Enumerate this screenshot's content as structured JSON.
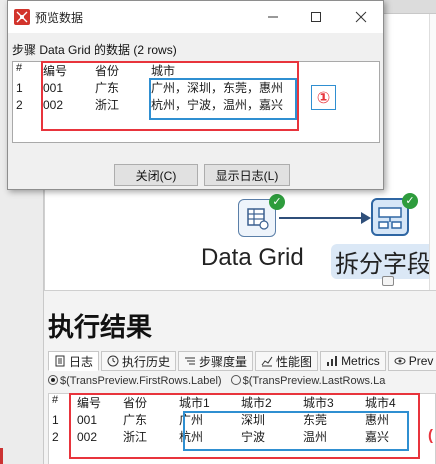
{
  "dialog": {
    "title": "预览数据",
    "caption": "步骤 Data Grid 的数据  (2 rows)",
    "columns": [
      "#",
      "编号",
      "省份",
      "城市"
    ],
    "rows": [
      [
        "1",
        "001",
        "广东",
        "广州，深圳，东莞，惠州"
      ],
      [
        "2",
        "002",
        "浙江",
        "杭州，宁波，温州，嘉兴"
      ]
    ],
    "close_label": "关闭(C)",
    "log_label": "显示日志(L)",
    "annotation_1": "①"
  },
  "canvas": {
    "step1_label": "Data Grid",
    "step2_label": "拆分字段"
  },
  "results": {
    "title": "执行结果",
    "tabs": [
      {
        "label": "日志",
        "icon": "log-icon"
      },
      {
        "label": "执行历史",
        "icon": "history-icon"
      },
      {
        "label": "步骤度量",
        "icon": "step-metrics-icon"
      },
      {
        "label": "性能图",
        "icon": "chart-icon"
      },
      {
        "label": "Metrics",
        "icon": "metrics-icon"
      },
      {
        "label": "Prev",
        "icon": "preview-eye-icon"
      }
    ],
    "radio_first": "$(TransPreview.FirstRows.Label)",
    "radio_last": "$(TransPreview.LastRows.La",
    "columns": [
      "#",
      "编号",
      "省份",
      "城市1",
      "城市2",
      "城市3",
      "城市4"
    ],
    "rows": [
      [
        "1",
        "001",
        "广东",
        "广州",
        "深圳",
        "东莞",
        "惠州"
      ],
      [
        "2",
        "002",
        "浙江",
        "杭州",
        "宁波",
        "温州",
        "嘉兴"
      ]
    ],
    "annotation_2": "("
  },
  "colors": {
    "annotation_red": "#e8343c",
    "annotation_blue": "#2f8fd1",
    "check_green": "#2e9c3d",
    "hop_color": "#2f4f7a"
  }
}
